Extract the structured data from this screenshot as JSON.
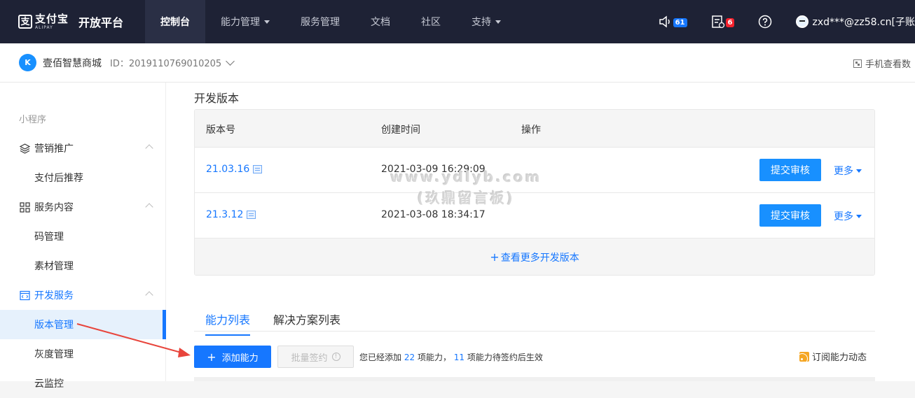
{
  "topbar": {
    "logo_cn": "支付宝",
    "logo_en": "ALIPAY",
    "brand_title": "开放平台",
    "nav": [
      {
        "label": "控制台",
        "active": true
      },
      {
        "label": "能力管理",
        "dropdown": true
      },
      {
        "label": "服务管理"
      },
      {
        "label": "文档"
      },
      {
        "label": "社区"
      },
      {
        "label": "支持",
        "dropdown": true
      }
    ],
    "notice_count": "61",
    "task_count": "6",
    "user": "zxd***@zz58.cn[子账"
  },
  "appbar": {
    "app_name": "壹佰智慧商城",
    "app_id": "ID：2019110769010205",
    "mobile_view": "手机查看数"
  },
  "sidebar": {
    "section": "小程序",
    "groups": [
      {
        "label": "营销推广",
        "items": [
          "支付后推荐"
        ]
      },
      {
        "label": "服务内容",
        "items": [
          "码管理",
          "素材管理"
        ]
      },
      {
        "label": "开发服务",
        "items": [
          "版本管理",
          "灰度管理",
          "云监控"
        ]
      }
    ]
  },
  "main": {
    "section_title": "开发版本",
    "columns": [
      "版本号",
      "创建时间",
      "操作"
    ],
    "rows": [
      {
        "version": "21.03.16",
        "created": "2021-03-09 16:29:09",
        "submit": "提交审核",
        "more": "更多"
      },
      {
        "version": "21.3.12",
        "created": "2021-03-08 18:34:17",
        "submit": "提交审核",
        "more": "更多"
      }
    ],
    "view_more": "查看更多开发版本",
    "watermark": [
      "www.ydlyb.com",
      "(玖鼎留言板)"
    ],
    "tabs": [
      "能力列表",
      "解决方案列表"
    ],
    "add_button": "添加能力",
    "batch_button": "批量签约",
    "stats": {
      "prefix": "您已经添加",
      "added": "22",
      "middle": "项能力，",
      "pending": "11",
      "suffix": "项能力待签约后生效"
    },
    "subscribe": "订阅能力动态"
  },
  "colors": {
    "topbar_bg": "#1e2235",
    "accent": "#1677ff",
    "arrow": "#e8453c"
  }
}
